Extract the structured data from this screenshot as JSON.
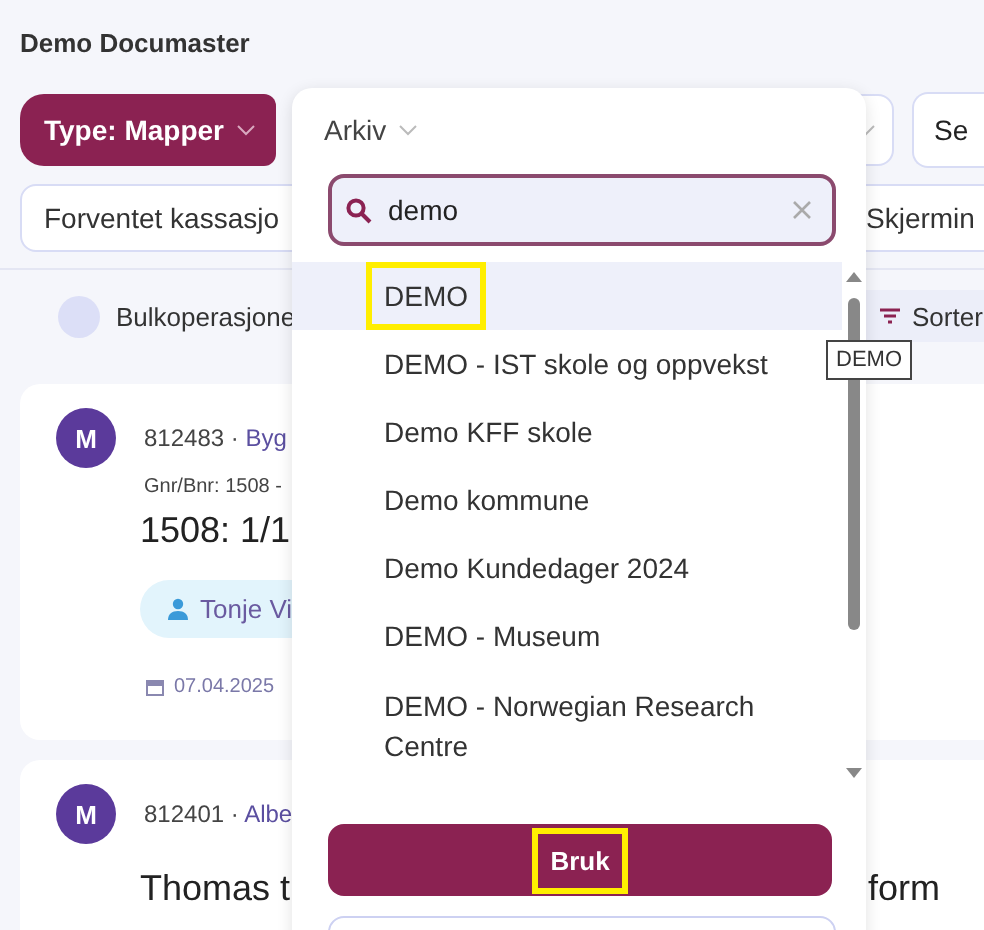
{
  "page_title": "Demo Documaster",
  "filters": {
    "type_chip": "Type: Mapper",
    "right_chip": "Se",
    "field": "Forventet kassasjo",
    "right_field": "Skjermin"
  },
  "toolbar": {
    "select_all": {
      "checked": false
    },
    "bulk": "Bulkoperasjone",
    "sort": "Sorter"
  },
  "cards": [
    {
      "avatar": "M",
      "number": "812483",
      "separator": "·",
      "category": "Byg",
      "meta": "Gnr/Bnr: 1508 -",
      "title": "1508: 1/1",
      "person": "Tonje Vi",
      "date": "07.04.2025"
    },
    {
      "avatar": "M",
      "number": "812401",
      "separator": "·",
      "category": "Albe",
      "title": "Thomas t",
      "right_text": "form"
    }
  ],
  "popover": {
    "label": "Arkiv",
    "search": {
      "value": "demo"
    },
    "items": [
      {
        "label": "DEMO",
        "selected": true,
        "annotated": true
      },
      {
        "label": "DEMO - IST skole og oppvekst",
        "selected": false,
        "annotated": false
      },
      {
        "label": "Demo KFF skole",
        "selected": false,
        "annotated": false
      },
      {
        "label": "Demo kommune",
        "selected": false,
        "annotated": false
      },
      {
        "label": "Demo Kundedager 2024",
        "selected": false,
        "annotated": false
      },
      {
        "label": "DEMO - Museum",
        "selected": false,
        "annotated": false
      },
      {
        "label": "DEMO - Norwegian Research Centre",
        "selected": false,
        "annotated": false
      }
    ],
    "apply_button": {
      "label": "Bruk",
      "annotated": true
    }
  },
  "tooltip": "DEMO"
}
